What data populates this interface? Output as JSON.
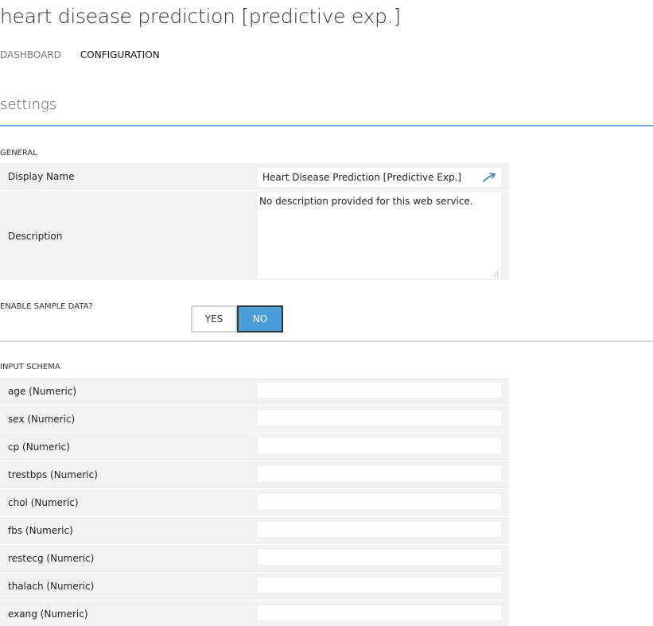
{
  "header": {
    "title": "heart disease prediction [predictive exp.]",
    "tabs": [
      {
        "label": "DASHBOARD",
        "active": false
      },
      {
        "label": "CONFIGURATION",
        "active": true
      }
    ]
  },
  "settings": {
    "title": "settings",
    "general": {
      "label": "GENERAL",
      "display_name_label": "Display Name",
      "display_name_value": "Heart Disease Prediction [Predictive Exp.]",
      "description_label": "Description",
      "description_value": "No description provided for this web service."
    },
    "sample_data": {
      "label": "ENABLE SAMPLE DATA?",
      "yes_label": "YES",
      "no_label": "NO",
      "selected": "NO"
    },
    "input_schema": {
      "label": "INPUT SCHEMA",
      "fields": [
        {
          "label": "age (Numeric)",
          "value": ""
        },
        {
          "label": "sex (Numeric)",
          "value": ""
        },
        {
          "label": "cp (Numeric)",
          "value": ""
        },
        {
          "label": "trestbps (Numeric)",
          "value": ""
        },
        {
          "label": "chol (Numeric)",
          "value": ""
        },
        {
          "label": "fbs (Numeric)",
          "value": ""
        },
        {
          "label": "restecg (Numeric)",
          "value": ""
        },
        {
          "label": "thalach (Numeric)",
          "value": ""
        },
        {
          "label": "exang (Numeric)",
          "value": ""
        }
      ]
    }
  },
  "colors": {
    "accent": "#4a9fd8",
    "rule": "#7fa7cf",
    "row_bg": "#f2f2f2",
    "edit_icon": "#2a7bb8"
  },
  "icons": {
    "edit": "pen-edit-icon",
    "resize": "resize-grip-icon"
  }
}
